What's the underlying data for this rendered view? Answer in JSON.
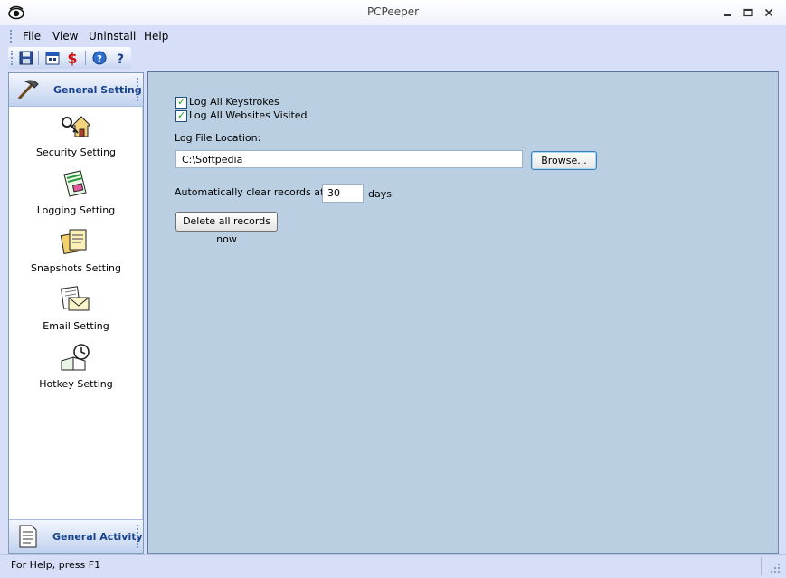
{
  "window": {
    "title": "PCPeeper"
  },
  "menu": {
    "file": "File",
    "view": "View",
    "uninstall": "Uninstall",
    "help": "Help"
  },
  "sidebar": {
    "header_top": "General Setting",
    "items": [
      {
        "label": "Security Setting",
        "icon": "house-key-icon"
      },
      {
        "label": "Logging Setting",
        "icon": "notebook-icon"
      },
      {
        "label": "Snapshots Setting",
        "icon": "pictures-icon"
      },
      {
        "label": "Email Setting",
        "icon": "envelope-icon"
      },
      {
        "label": "Hotkey Setting",
        "icon": "clock-book-icon"
      }
    ],
    "header_bottom": "General Activity"
  },
  "settings": {
    "log_keystrokes": {
      "label": "Log All Keystrokes",
      "checked": true
    },
    "log_websites": {
      "label": "Log All Websites Visited",
      "checked": true
    },
    "log_location_label": "Log File Location:",
    "log_location_value": "C:\\Softpedia",
    "browse_label": "Browse...",
    "auto_clear_label": "Automatically clear records after",
    "auto_clear_value": "30",
    "auto_clear_unit": "days",
    "delete_label": "Delete all records now"
  },
  "status": {
    "text": "For Help, press F1"
  },
  "colors": {
    "content_bg": "#bbcfe2",
    "header_text": "#15428b",
    "chrome": "#d6dff7"
  }
}
